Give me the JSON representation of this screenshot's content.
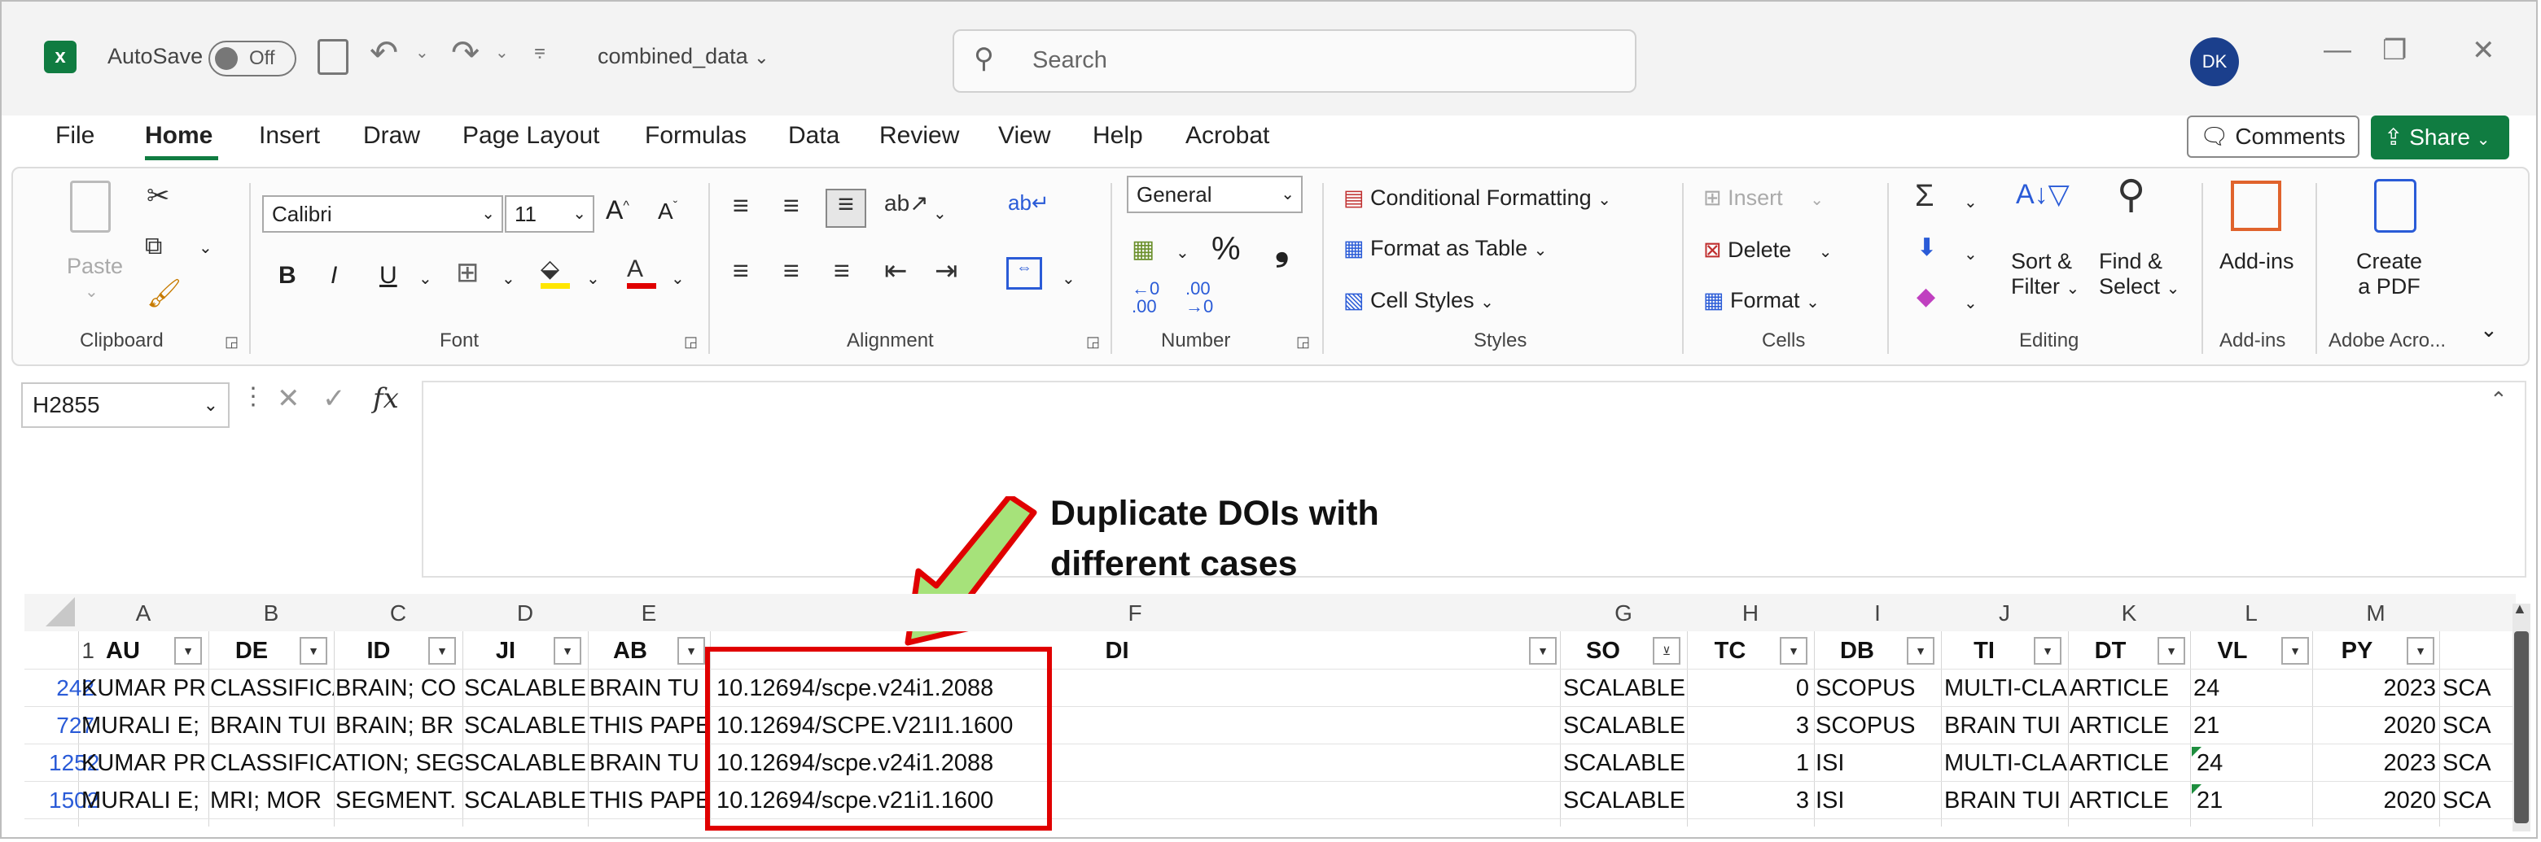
{
  "titlebar": {
    "autosave_label": "AutoSave",
    "autosave_state": "Off",
    "filename": "combined_data",
    "search_placeholder": "Search",
    "user_initials": "DK"
  },
  "menu": {
    "items": [
      "File",
      "Home",
      "Insert",
      "Draw",
      "Page Layout",
      "Formulas",
      "Data",
      "Review",
      "View",
      "Help",
      "Acrobat"
    ],
    "active": "Home",
    "comments_label": "Comments",
    "share_label": "Share"
  },
  "ribbon": {
    "clipboard": {
      "paste": "Paste",
      "group": "Clipboard"
    },
    "font": {
      "name": "Calibri",
      "size": "11",
      "bold": "B",
      "italic": "I",
      "underline": "U",
      "group": "Font"
    },
    "alignment": {
      "group": "Alignment"
    },
    "number": {
      "format": "General",
      "percent": "%",
      "comma": "❟",
      "group": "Number"
    },
    "styles": {
      "conditional": "Conditional Formatting",
      "format_table": "Format as Table",
      "cell_styles": "Cell Styles",
      "group": "Styles"
    },
    "cells": {
      "insert": "Insert",
      "delete": "Delete",
      "format": "Format",
      "group": "Cells"
    },
    "editing": {
      "sort_filter_1": "Sort &",
      "sort_filter_2": "Filter",
      "find_select_1": "Find &",
      "find_select_2": "Select",
      "group": "Editing"
    },
    "addins": {
      "label": "Add-ins",
      "group": "Add-ins"
    },
    "adobe": {
      "create_1": "Create",
      "create_2": "a PDF",
      "group": "Adobe Acro..."
    }
  },
  "formula_bar": {
    "name_box": "H2855",
    "fx": "fx",
    "value": ""
  },
  "annotation": {
    "line1": "Duplicate DOIs with",
    "line2": "different cases"
  },
  "sheet": {
    "column_letters": [
      "A",
      "B",
      "C",
      "D",
      "E",
      "F",
      "G",
      "H",
      "I",
      "J",
      "K",
      "L",
      "M"
    ],
    "header_row_number": "1",
    "headers": [
      "AU",
      "DE",
      "ID",
      "JI",
      "AB",
      "DI",
      "SO",
      "TC",
      "DB",
      "TI",
      "DT",
      "VL",
      "PY"
    ],
    "rows": [
      {
        "num": "242",
        "AU": "KUMAR PR",
        "DE": "CLASSIFICA",
        "ID": "BRAIN; CO",
        "JI": "SCALABLE",
        "AB": "BRAIN TU",
        "DI": "10.12694/scpe.v24i1.2088",
        "SO": "SCALABLE",
        "TC": "0",
        "DB": "SCOPUS",
        "TI": "MULTI-CLA",
        "DT": "ARTICLE",
        "VL": "24",
        "PY": "2023",
        "N": "SCA"
      },
      {
        "num": "727",
        "AU": "MURALI E;",
        "DE": "BRAIN TUI",
        "ID": "BRAIN; BR",
        "JI": "SCALABLE",
        "AB": "THIS PAPE",
        "DI": "10.12694/SCPE.V21I1.1600",
        "SO": "SCALABLE",
        "TC": "3",
        "DB": "SCOPUS",
        "TI": "BRAIN TUI",
        "DT": "ARTICLE",
        "VL": "21",
        "PY": "2020",
        "N": "SCA"
      },
      {
        "num": "1252",
        "AU": "KUMAR PR",
        "DE": "CLASSIFICATION; SEG",
        "ID": "",
        "JI": "SCALABLE",
        "AB": "BRAIN TU",
        "DI": "10.12694/scpe.v24i1.2088",
        "SO": "SCALABLE",
        "TC": "1",
        "DB": "ISI",
        "TI": "MULTI-CLA",
        "DT": "ARTICLE",
        "VL": "24",
        "PY": "2023",
        "N": "SCA"
      },
      {
        "num": "1502",
        "AU": "MURALI E;",
        "DE": "MRI; MOR",
        "ID": "SEGMENT.",
        "JI": "SCALABLE",
        "AB": "THIS PAPE",
        "DI": "10.12694/scpe.v21i1.1600",
        "SO": "SCALABLE",
        "TC": "3",
        "DB": "ISI",
        "TI": "BRAIN TUI",
        "DT": "ARTICLE",
        "VL": "21",
        "PY": "2020",
        "N": "SCA"
      }
    ]
  },
  "colors": {
    "excel_green": "#107c41",
    "highlight_red": "#e00000",
    "arrow_green": "#a6e27a"
  }
}
